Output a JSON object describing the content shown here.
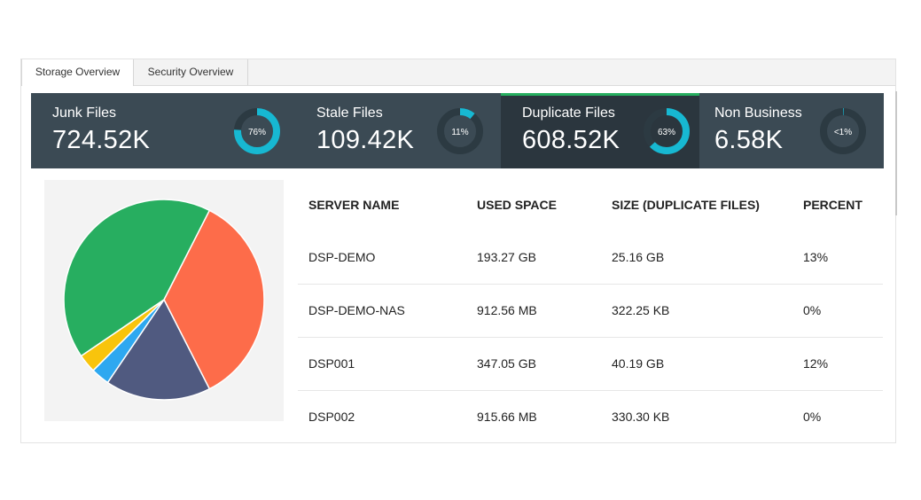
{
  "tabs": [
    {
      "label": "Storage Overview",
      "active": true
    },
    {
      "label": "Security Overview",
      "active": false
    }
  ],
  "cards": [
    {
      "title": "Junk Files",
      "value": "724.52K",
      "percent": 76,
      "percent_label": "76%"
    },
    {
      "title": "Stale Files",
      "value": "109.42K",
      "percent": 11,
      "percent_label": "11%"
    },
    {
      "title": "Duplicate Files",
      "value": "608.52K",
      "percent": 63,
      "percent_label": "63%",
      "active": true
    },
    {
      "title": "Non Business",
      "value": "6.58K",
      "percent": 0.5,
      "percent_label": "<1%"
    }
  ],
  "colors": {
    "card_bg": "#3b4a54",
    "card_active_bg": "#2b363e",
    "active_indicator": "#27ae60",
    "donut_fill": "#17b8d2",
    "donut_track": "#2c3a42"
  },
  "chart_data": {
    "type": "pie",
    "values": [
      35,
      17,
      3,
      3,
      42
    ],
    "colors": [
      "#fd6c4a",
      "#505a80",
      "#2ea8f0",
      "#f8c40c",
      "#27ae60"
    ]
  },
  "table": {
    "headers": [
      "SERVER NAME",
      "USED SPACE",
      "SIZE (DUPLICATE FILES)",
      "PERCENT"
    ],
    "rows": [
      [
        "DSP-DEMO",
        "193.27 GB",
        "25.16 GB",
        "13%"
      ],
      [
        "DSP-DEMO-NAS",
        "912.56 MB",
        "322.25 KB",
        "0%"
      ],
      [
        "DSP001",
        "347.05 GB",
        "40.19 GB",
        "12%"
      ],
      [
        "DSP002",
        "915.66 MB",
        "330.30 KB",
        "0%"
      ]
    ]
  }
}
